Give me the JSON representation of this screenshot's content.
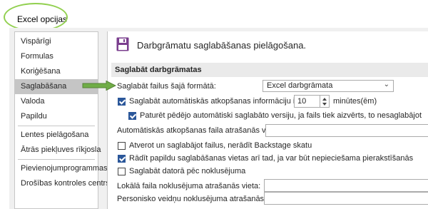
{
  "window": {
    "title": "Excel opcijas"
  },
  "sidebar": {
    "items": [
      {
        "label": "Vispārīgi"
      },
      {
        "label": "Formulas"
      },
      {
        "label": "Koriģēšana"
      },
      {
        "label": "Saglabāšana",
        "selected": true
      },
      {
        "label": "Valoda"
      },
      {
        "label": "Papildu"
      },
      {
        "label": "Lentes pielāgošana"
      },
      {
        "label": "Ātrās piekļuves rīkjosla"
      },
      {
        "label": "Pievienojumprogrammas"
      },
      {
        "label": "Drošības kontroles centrs"
      }
    ]
  },
  "main": {
    "header": "Darbgrāmatu saglabāšanas pielāgošana.",
    "section_title": "Saglabāt darbgrāmatas",
    "save_format_label": "Saglabāt failus šajā formātā:",
    "save_format_value": "Excel darbgrāmata",
    "autorecover_label": "Saglabāt automātiskās atkopšanas informāciju ik pēc",
    "autorecover_checked": true,
    "autorecover_minutes": "10",
    "minutes_label": "minūtes(ēm)",
    "keep_last_label": "Paturēt pēdējo automātiski saglabāto versiju, ja fails tiek aizvērts, to nesaglabājot",
    "keep_last_checked": true,
    "autorecover_location_label": "Automātiskās atkopšanas faila atrašanās vieta:",
    "backstage_label": "Atverot un saglabājot failus, nerādīt Backstage skatu",
    "backstage_checked": false,
    "show_places_label": "Rādīt papildu saglabāšanas vietas arī tad, ja var būt nepieciešama pierakstīšanās",
    "show_places_checked": true,
    "save_computer_label": "Saglabāt datorā pēc noklusējuma",
    "save_computer_checked": false,
    "local_location_label": "Lokālā faila noklusējuma atrašanās vieta:",
    "personal_templates_label": "Personisko veidņu noklusējuma atrašanās vieta:"
  },
  "colors": {
    "highlight_ellipse": "#92d050",
    "arrow": "#70ad47",
    "checkbox_checked": "#2b579a",
    "selected_nav": "#c5c5c5"
  },
  "icons": {
    "header": "floppy-disk-icon",
    "dropdown": "chevron-down-icon"
  }
}
